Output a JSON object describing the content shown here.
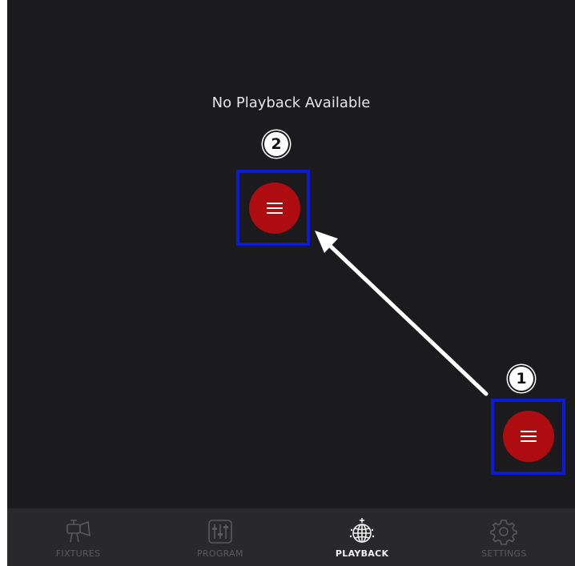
{
  "main": {
    "empty_message": "No Playback Available"
  },
  "annotations": {
    "step_1": "1",
    "step_2": "2",
    "highlight_color": "#0b1bd8",
    "arrow_color": "#ffffff"
  },
  "fab": {
    "icon": "menu-icon",
    "color": "#ad0d11"
  },
  "bottom_nav": {
    "items": [
      {
        "label": "FIXTURES",
        "icon": "fixture-spotlight-icon",
        "active": false
      },
      {
        "label": "PROGRAM",
        "icon": "faders-icon",
        "active": false
      },
      {
        "label": "PLAYBACK",
        "icon": "disco-ball-icon",
        "active": true
      },
      {
        "label": "SETTINGS",
        "icon": "gear-icon",
        "active": false
      }
    ]
  }
}
